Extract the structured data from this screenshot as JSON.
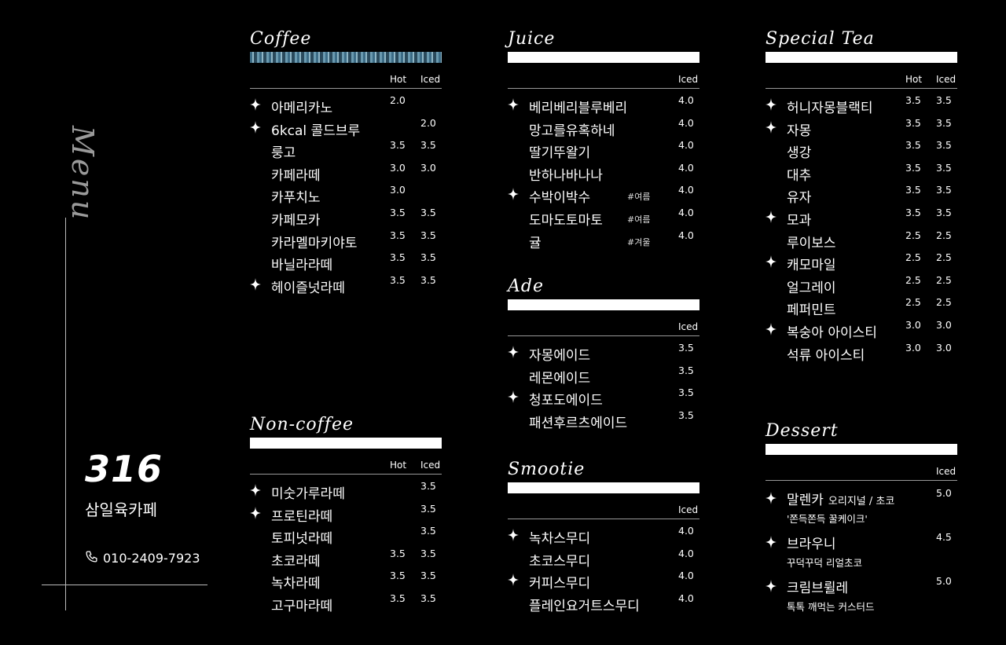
{
  "side": {
    "menu_title": "Menu",
    "brand_number": "316",
    "brand_name": "삼일육카페",
    "phone": "010-2409-7923"
  },
  "headers": {
    "hot": "Hot",
    "iced": "Iced"
  },
  "coffee": {
    "title": "Coffee",
    "items": [
      {
        "star": true,
        "name": "아메리카노",
        "hot": "2.0",
        "iced": ""
      },
      {
        "star": true,
        "name": "6kcal 콜드브루",
        "hot": "",
        "iced": "2.0"
      },
      {
        "star": false,
        "name": "룽고",
        "hot": "3.5",
        "iced": "3.5"
      },
      {
        "star": false,
        "name": "카페라떼",
        "hot": "3.0",
        "iced": "3.0"
      },
      {
        "star": false,
        "name": "카푸치노",
        "hot": "3.0",
        "iced": ""
      },
      {
        "star": false,
        "name": "카페모카",
        "hot": "3.5",
        "iced": "3.5"
      },
      {
        "star": false,
        "name": "카라멜마키야토",
        "hot": "3.5",
        "iced": "3.5"
      },
      {
        "star": false,
        "name": "바닐라라떼",
        "hot": "3.5",
        "iced": "3.5"
      },
      {
        "star": true,
        "name": "헤이즐넛라떼",
        "hot": "3.5",
        "iced": "3.5"
      }
    ]
  },
  "noncoffee": {
    "title": "Non-coffee",
    "items": [
      {
        "star": true,
        "name": "미숫가루라떼",
        "hot": "",
        "iced": "3.5"
      },
      {
        "star": true,
        "name": "프로틴라떼",
        "hot": "",
        "iced": "3.5"
      },
      {
        "star": false,
        "name": "토피넛라떼",
        "hot": "",
        "iced": "3.5"
      },
      {
        "star": false,
        "name": "초코라떼",
        "hot": "3.5",
        "iced": "3.5"
      },
      {
        "star": false,
        "name": "녹차라떼",
        "hot": "3.5",
        "iced": "3.5"
      },
      {
        "star": false,
        "name": "고구마라떼",
        "hot": "3.5",
        "iced": "3.5"
      }
    ]
  },
  "juice": {
    "title": "Juice",
    "items": [
      {
        "star": true,
        "name": "베리베리블루베리",
        "tag": "",
        "iced": "4.0"
      },
      {
        "star": false,
        "name": "망고를유혹하네",
        "tag": "",
        "iced": "4.0"
      },
      {
        "star": false,
        "name": "딸기뚜왈기",
        "tag": "",
        "iced": "4.0"
      },
      {
        "star": false,
        "name": "반하나바나나",
        "tag": "",
        "iced": "4.0"
      },
      {
        "star": true,
        "name": "수박이박수",
        "tag": "#여름",
        "iced": "4.0"
      },
      {
        "star": false,
        "name": "도마도토마토",
        "tag": "#여름",
        "iced": "4.0"
      },
      {
        "star": false,
        "name": "귤",
        "tag": "#겨울",
        "iced": "4.0"
      }
    ]
  },
  "ade": {
    "title": "Ade",
    "items": [
      {
        "star": true,
        "name": "자몽에이드",
        "iced": "3.5"
      },
      {
        "star": false,
        "name": "레몬에이드",
        "iced": "3.5"
      },
      {
        "star": true,
        "name": "청포도에이드",
        "iced": "3.5"
      },
      {
        "star": false,
        "name": "패션후르츠에이드",
        "iced": "3.5"
      }
    ]
  },
  "smootie": {
    "title": "Smootie",
    "items": [
      {
        "star": true,
        "name": "녹차스무디",
        "iced": "4.0"
      },
      {
        "star": false,
        "name": "초코스무디",
        "iced": "4.0"
      },
      {
        "star": true,
        "name": "커피스무디",
        "iced": "4.0"
      },
      {
        "star": false,
        "name": "플레인요거트스무디",
        "iced": "4.0"
      }
    ]
  },
  "special_tea": {
    "title": "Special Tea",
    "items": [
      {
        "star": true,
        "name": "허니자몽블랙티",
        "hot": "3.5",
        "iced": "3.5"
      },
      {
        "star": true,
        "name": "자몽",
        "hot": "3.5",
        "iced": "3.5"
      },
      {
        "star": false,
        "name": "생강",
        "hot": "3.5",
        "iced": "3.5"
      },
      {
        "star": false,
        "name": "대추",
        "hot": "3.5",
        "iced": "3.5"
      },
      {
        "star": false,
        "name": "유자",
        "hot": "3.5",
        "iced": "3.5"
      },
      {
        "star": true,
        "name": "모과",
        "hot": "3.5",
        "iced": "3.5"
      },
      {
        "star": false,
        "name": "루이보스",
        "hot": "2.5",
        "iced": "2.5"
      },
      {
        "star": true,
        "name": "캐모마일",
        "hot": "2.5",
        "iced": "2.5"
      },
      {
        "star": false,
        "name": "얼그레이",
        "hot": "2.5",
        "iced": "2.5"
      },
      {
        "star": false,
        "name": "페퍼민트",
        "hot": "2.5",
        "iced": "2.5"
      },
      {
        "star": true,
        "name": "복숭아 아이스티",
        "hot": "3.0",
        "iced": "3.0"
      },
      {
        "star": false,
        "name": "석류 아이스티",
        "hot": "3.0",
        "iced": "3.0"
      }
    ]
  },
  "dessert": {
    "title": "Dessert",
    "items": [
      {
        "star": true,
        "name": "말렌카",
        "option": "오리지널 / 초코",
        "desc": "'쫀득쫀득 꿀케이크'",
        "iced": "5.0"
      },
      {
        "star": true,
        "name": "브라우니",
        "option": "",
        "desc": "꾸덕꾸덕 리얼초코",
        "iced": "4.5"
      },
      {
        "star": true,
        "name": "크림브륄레",
        "option": "",
        "desc": "톡톡 깨먹는 커스터드",
        "iced": "5.0"
      }
    ]
  }
}
